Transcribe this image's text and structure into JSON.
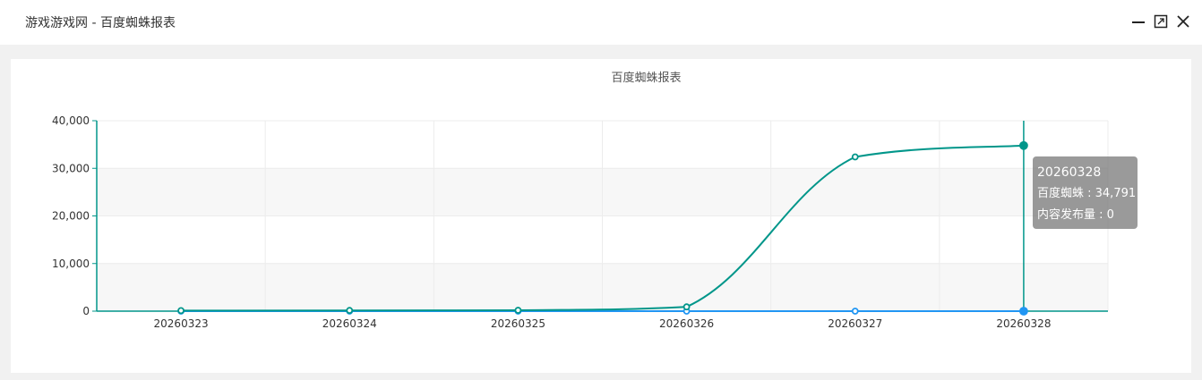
{
  "window": {
    "title": "游戏游戏网 - 百度蜘蛛报表",
    "buttons": [
      "minimize",
      "maximize",
      "close"
    ]
  },
  "chart_data": {
    "type": "line",
    "title": "百度蜘蛛报表",
    "categories": [
      "20260323",
      "20260324",
      "20260325",
      "20260326",
      "20260327",
      "20260328"
    ],
    "series": [
      {
        "name": "百度蜘蛛",
        "color": "#00968a",
        "values": [
          120,
          150,
          180,
          900,
          32400,
          34791
        ]
      },
      {
        "name": "内容发布量",
        "color": "#2196f3",
        "values": [
          0,
          0,
          0,
          0,
          0,
          0
        ]
      }
    ],
    "y_ticks": [
      "0",
      "10,000",
      "20,000",
      "30,000",
      "40,000"
    ],
    "ylim": [
      0,
      40000
    ],
    "grid": true,
    "axis_color": "#00968a",
    "highlight_index": 5
  },
  "tooltip": {
    "title": "20260328",
    "line1": "百度蜘蛛 : 34,791",
    "line2": "内容发布量 : 0"
  }
}
